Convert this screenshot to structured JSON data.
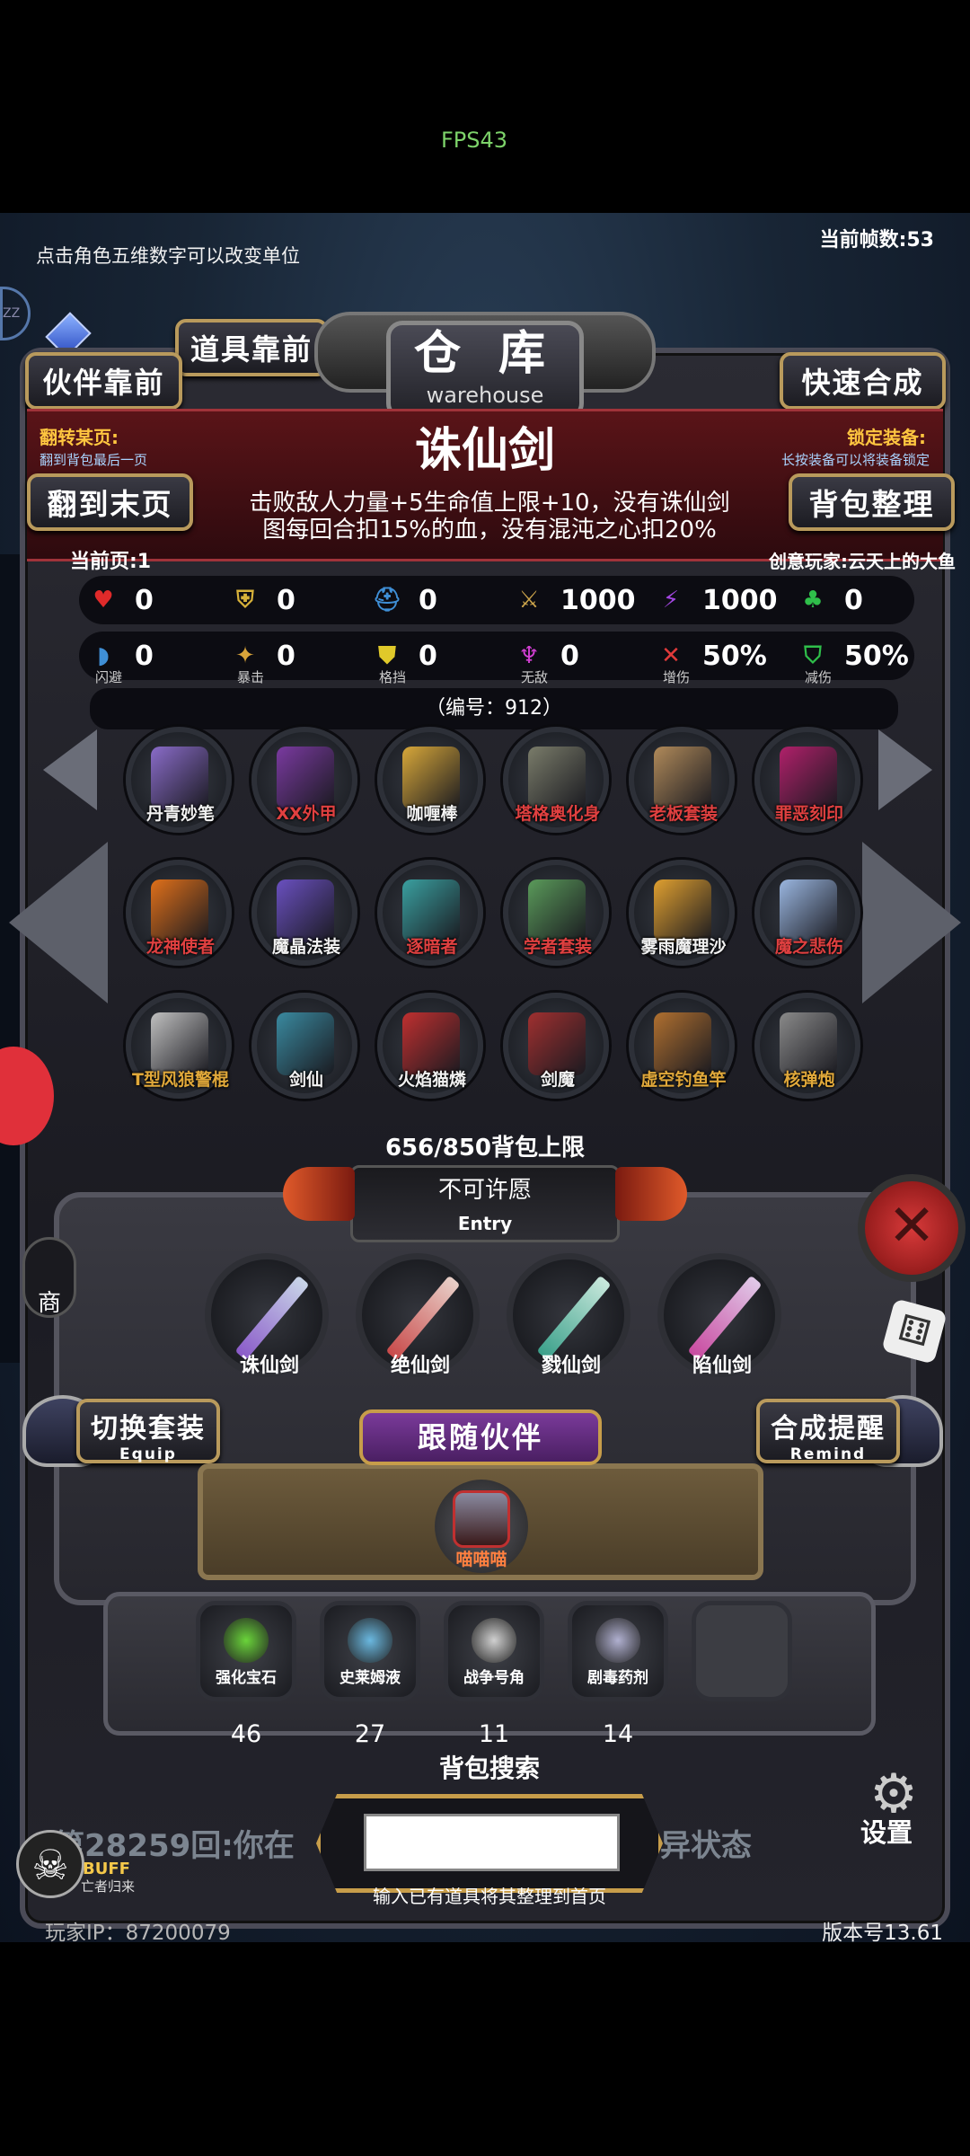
{
  "status": {
    "fps": "FPS43"
  },
  "top": {
    "hint": "点击角色五维数字可以改变单位",
    "frame_counter": "当前帧数:53"
  },
  "header": {
    "title_cn": "仓 库",
    "title_en": "warehouse",
    "partner_front": "伙伴靠前",
    "items_front": "道具靠前",
    "quick_synth": "快速合成",
    "flip_label": "翻转某页:",
    "flip_sub": "翻到背包最后一页",
    "flip_button": "翻到末页",
    "lock_label": "锁定装备:",
    "lock_sub": "长按装备可以将装备锁定",
    "bag_sort": "背包整理",
    "current_page": "当前页:1",
    "creator": "创意玩家:云天上的大鱼"
  },
  "item": {
    "name": "诛仙剑",
    "desc_line1": "击败敌人力量+5生命值上限+10，没有诛仙剑",
    "desc_line2": "图每回合扣15%的血，没有混沌之心扣20%",
    "id": "（编号：912）"
  },
  "stats_row1": [
    {
      "icon": "heart-icon",
      "value": "0",
      "color": "#e02a2a"
    },
    {
      "icon": "armor-icon",
      "value": "0",
      "color": "#d8b23a"
    },
    {
      "icon": "helmet-icon",
      "value": "0",
      "color": "#3f8fd6"
    },
    {
      "icon": "sword-icon",
      "value": "1000",
      "color": "#c9a24a"
    },
    {
      "icon": "lightning-icon",
      "value": "1000",
      "color": "#a246e0"
    },
    {
      "icon": "clover-icon",
      "value": "0",
      "color": "#2fbf4a"
    }
  ],
  "stats_row2": [
    {
      "icon": "dodge-icon",
      "value": "0",
      "label": "闪避",
      "color": "#3f8fd6"
    },
    {
      "icon": "crit-icon",
      "value": "0",
      "label": "暴击",
      "color": "#d8a43a"
    },
    {
      "icon": "block-icon",
      "value": "0",
      "label": "格挡",
      "color": "#e0c92a"
    },
    {
      "icon": "invincible-icon",
      "value": "0",
      "label": "无敌",
      "color": "#d43fd4"
    },
    {
      "icon": "damage-up-icon",
      "value": "50%",
      "label": "增伤",
      "color": "#e03a3a"
    },
    {
      "icon": "damage-reduce-icon",
      "value": "50%",
      "label": "减伤",
      "color": "#2fbf4a"
    }
  ],
  "grid": [
    {
      "name": "丹青妙笔",
      "color": "#f2f2f2",
      "art": "#8a6cc9"
    },
    {
      "name": "XX外甲",
      "color": "#e04040",
      "art": "#7a3aa0"
    },
    {
      "name": "咖喱棒",
      "color": "#f2f2f2",
      "art": "#d8a83a"
    },
    {
      "name": "塔格奥化身",
      "color": "#e04040",
      "art": "#7a7c6a"
    },
    {
      "name": "老板套装",
      "color": "#e04040",
      "art": "#b08a5a"
    },
    {
      "name": "罪恶刻印",
      "color": "#e04040",
      "art": "#b0206a"
    },
    {
      "name": "龙神使者",
      "color": "#e04040",
      "art": "#e0701a"
    },
    {
      "name": "魔晶法装",
      "color": "#f2f2f2",
      "art": "#6a50c0"
    },
    {
      "name": "逐暗者",
      "color": "#e04040",
      "art": "#3aa0a0"
    },
    {
      "name": "学者套装",
      "color": "#e04040",
      "art": "#5a9a5a"
    },
    {
      "name": "雾雨魔理沙",
      "color": "#f2f2f2",
      "art": "#e0a030"
    },
    {
      "name": "魔之悲伤",
      "color": "#e04040",
      "art": "#9ab6e0"
    },
    {
      "name": "T型风狼警棍",
      "color": "#e0a83a",
      "art": "#c0c0c0"
    },
    {
      "name": "剑仙",
      "color": "#f2f2f2",
      "art": "#3a8aa0"
    },
    {
      "name": "火焰猫燐",
      "color": "#f2f2f2",
      "art": "#c03030"
    },
    {
      "name": "剑魔",
      "color": "#f2f2f2",
      "art": "#a03030"
    },
    {
      "name": "虚空钓鱼竿",
      "color": "#e0a83a",
      "art": "#b07030"
    },
    {
      "name": "核弹炮",
      "color": "#e0a83a",
      "art": "#8a8a8a"
    }
  ],
  "capacity": "656/850背包上限",
  "entry": {
    "title": "不可许愿",
    "sub": "Entry"
  },
  "swords": [
    {
      "name": "诛仙剑",
      "blade": "#c9d6e8",
      "hilt": "#8a5ac9"
    },
    {
      "name": "绝仙剑",
      "blade": "#e8d0c9",
      "hilt": "#c94a4a"
    },
    {
      "name": "戮仙剑",
      "blade": "#c9e8dc",
      "hilt": "#3aa08a"
    },
    {
      "name": "陷仙剑",
      "blade": "#e0c9e8",
      "hilt": "#c94aa0"
    }
  ],
  "equip": {
    "label": "切换套装",
    "sub": "Equip"
  },
  "remind": {
    "label": "合成提醒",
    "sub": "Remind"
  },
  "partner": {
    "ribbon": "跟随伙伴",
    "name": "喵喵喵"
  },
  "consumables": [
    {
      "name": "强化宝石",
      "count": "46",
      "art": "#6ad43a"
    },
    {
      "name": "史莱姆液",
      "count": "27",
      "art": "#6ab8e0"
    },
    {
      "name": "战争号角",
      "count": "11",
      "art": "#d0d0d0"
    },
    {
      "name": "剧毒药剂",
      "count": "14",
      "art": "#b0b0d0"
    },
    {
      "name": "",
      "count": "",
      "art": ""
    }
  ],
  "search": {
    "label": "背包搜索",
    "placeholder": "",
    "hint": "输入已有道具将其整理到首页"
  },
  "log_text": "第28259回:你在",
  "log_suffix": "异状态",
  "side": {
    "shop": "商",
    "settings": "设置"
  },
  "buff": {
    "label": "BUFF",
    "sub": "亡者归来"
  },
  "footer": {
    "ip": "玩家IP：87200079",
    "version": "版本号13.61"
  }
}
